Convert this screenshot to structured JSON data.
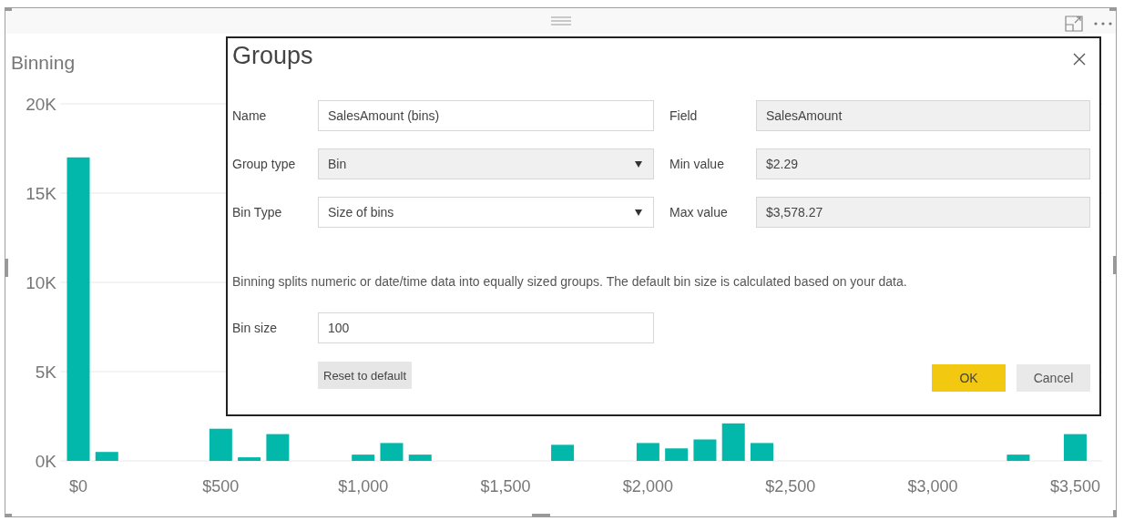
{
  "visual": {
    "title": "Binning",
    "chart_data": {
      "type": "bar",
      "x": [
        0,
        100,
        200,
        300,
        400,
        500,
        600,
        700,
        800,
        900,
        1000,
        1100,
        1200,
        1300,
        1400,
        1500,
        1600,
        1700,
        1800,
        1900,
        2000,
        2100,
        2200,
        2300,
        2400,
        2500,
        2600,
        2700,
        2800,
        2900,
        3000,
        3100,
        3200,
        3300,
        3400,
        3500
      ],
      "series": [
        {
          "color": "#01b8aa",
          "values": [
            17000,
            500,
            0,
            0,
            0,
            1800,
            200,
            1500,
            0,
            0,
            350,
            1000,
            350,
            0,
            0,
            0,
            0,
            900,
            0,
            0,
            1000,
            700,
            1200,
            2100,
            1000,
            0,
            0,
            0,
            0,
            0,
            0,
            0,
            0,
            350,
            0,
            1500
          ]
        }
      ],
      "xlim": [
        -50,
        3550
      ],
      "ylim": [
        0,
        20000
      ],
      "grid": true,
      "yticks": [
        {
          "value": 0,
          "label": "0K"
        },
        {
          "value": 5000,
          "label": "5K"
        },
        {
          "value": 10000,
          "label": "10K"
        },
        {
          "value": 15000,
          "label": "15K"
        },
        {
          "value": 20000,
          "label": "20K"
        }
      ],
      "xticks": [
        {
          "value": 0,
          "label": "$0"
        },
        {
          "value": 500,
          "label": "$500"
        },
        {
          "value": 1000,
          "label": "$1,000"
        },
        {
          "value": 1500,
          "label": "$1,500"
        },
        {
          "value": 2000,
          "label": "$2,000"
        },
        {
          "value": 2500,
          "label": "$2,500"
        },
        {
          "value": 3000,
          "label": "$3,000"
        },
        {
          "value": 3500,
          "label": "$3,500"
        }
      ]
    }
  },
  "dialog": {
    "title": "Groups",
    "fields": [
      {
        "label": "Name",
        "value": "SalesAmount (bins)",
        "kind": "text",
        "disabled": false
      },
      {
        "label": "Field",
        "value": "SalesAmount",
        "kind": "text",
        "disabled": true
      },
      {
        "label": "Group type",
        "value": "Bin",
        "kind": "dropdown",
        "disabled": true
      },
      {
        "label": "Min value",
        "value": "$2.29",
        "kind": "text",
        "disabled": true
      },
      {
        "label": "Bin Type",
        "value": "Size of bins",
        "kind": "dropdown",
        "disabled": false
      },
      {
        "label": "Max value",
        "value": "$3,578.27",
        "kind": "text",
        "disabled": true
      }
    ],
    "description": "Binning splits numeric or date/time data into equally sized groups. The default bin size is calculated based on your data.",
    "bin_size": {
      "label": "Bin size",
      "value": "100"
    },
    "reset_button": "Reset to default",
    "buttons": [
      {
        "label": "OK",
        "primary": true
      },
      {
        "label": "Cancel",
        "primary": false
      }
    ]
  }
}
